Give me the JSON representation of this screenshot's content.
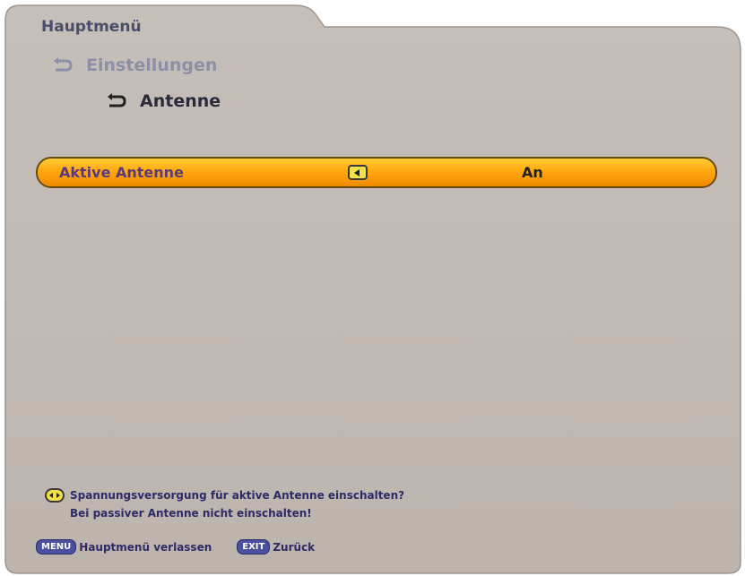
{
  "header": {
    "title": "Hauptmenü"
  },
  "breadcrumb": {
    "level1": "Einstellungen",
    "level2": "Antenne"
  },
  "setting": {
    "label": "Aktive Antenne",
    "value": "An"
  },
  "help": {
    "line1": "Spannungsversorgung für aktive Antenne einschalten?",
    "line2": "Bei passiver Antenne nicht einschalten!"
  },
  "footer": {
    "menu_key": "MENU",
    "menu_label": "Hauptmenü verlassen",
    "exit_key": "EXIT",
    "exit_label": "Zurück"
  },
  "colors": {
    "panel": "#c2bab5",
    "highlight": "#ffa80f",
    "text_dark": "#2e2a66",
    "key_blue": "#4b4f9e"
  }
}
